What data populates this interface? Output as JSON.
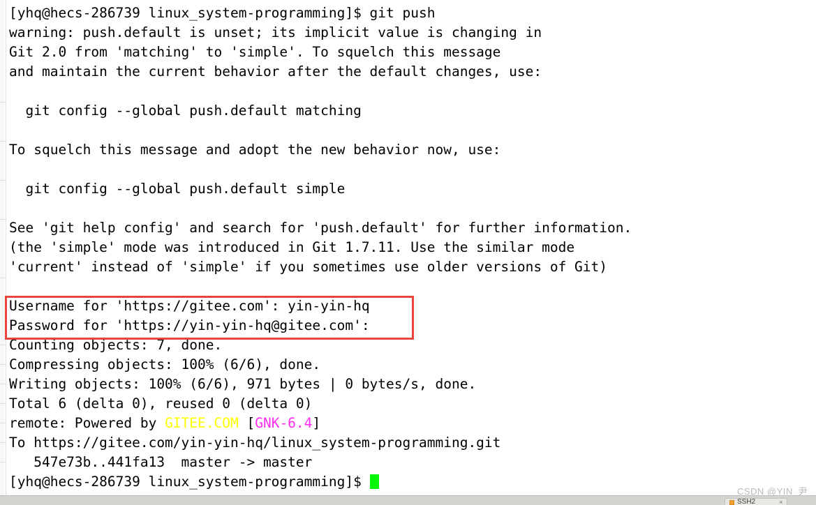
{
  "terminal": {
    "prompt": "[yhq@hecs-286739 linux_system-programming]$ ",
    "lines": [
      {
        "id": "line-command-git-push",
        "text": "[yhq@hecs-286739 linux_system-programming]$ git push"
      },
      {
        "id": "line-warning-1",
        "text": "warning: push.default is unset; its implicit value is changing in"
      },
      {
        "id": "line-warning-2",
        "text": "Git 2.0 from 'matching' to 'simple'. To squelch this message"
      },
      {
        "id": "line-warning-3",
        "text": "and maintain the current behavior after the default changes, use:"
      },
      {
        "id": "line-blank-1",
        "text": ""
      },
      {
        "id": "line-config-matching",
        "text": "  git config --global push.default matching"
      },
      {
        "id": "line-blank-2",
        "text": ""
      },
      {
        "id": "line-squelch-adopt",
        "text": "To squelch this message and adopt the new behavior now, use:"
      },
      {
        "id": "line-blank-3",
        "text": ""
      },
      {
        "id": "line-config-simple",
        "text": "  git config --global push.default simple"
      },
      {
        "id": "line-blank-4",
        "text": ""
      },
      {
        "id": "line-see-help-1",
        "text": "See 'git help config' and search for 'push.default' for further information."
      },
      {
        "id": "line-see-help-2",
        "text": "(the 'simple' mode was introduced in Git 1.7.11. Use the similar mode"
      },
      {
        "id": "line-see-help-3",
        "text": "'current' instead of 'simple' if you sometimes use older versions of Git)"
      },
      {
        "id": "line-blank-5",
        "text": ""
      },
      {
        "id": "line-username-prompt",
        "text": "Username for 'https://gitee.com': yin-yin-hq"
      },
      {
        "id": "line-password-prompt",
        "text": "Password for 'https://yin-yin-hq@gitee.com':"
      },
      {
        "id": "line-counting-objects",
        "text": "Counting objects: 7, done."
      },
      {
        "id": "line-compressing-objects",
        "text": "Compressing objects: 100% (6/6), done."
      },
      {
        "id": "line-writing-objects",
        "text": "Writing objects: 100% (6/6), 971 bytes | 0 bytes/s, done."
      },
      {
        "id": "line-total-objects",
        "text": "Total 6 (delta 0), reused 0 (delta 0)"
      }
    ],
    "remote_line": {
      "prefix": "remote: Powered by ",
      "gitee": "GITEE.COM",
      "mid": " [",
      "gnk": "GNK-6.4",
      "suffix": "]"
    },
    "to_url_line": "To https://gitee.com/yin-yin-hq/linux_system-programming.git",
    "push_result_line": "   547e73b..441fa13  master -> master",
    "final_prompt": "[yhq@hecs-286739 linux_system-programming]$ "
  },
  "annotation": {
    "highlight_box_color": "#e8453c",
    "highlight_note": "Username for 'https://gitee.com': yin-yin-hq / Password for 'https://yin-yin-hq@gitee.com':"
  },
  "colors": {
    "foreground": "#000000",
    "background": "#ffffff",
    "yellow": "#ffff00",
    "magenta": "#ff2cf1",
    "cursor_green": "#00f900"
  },
  "watermark": {
    "text": "CSDN @YIN_尹"
  },
  "bottom_bar": {
    "tab_label": "SSH2",
    "tab_close": "×"
  }
}
